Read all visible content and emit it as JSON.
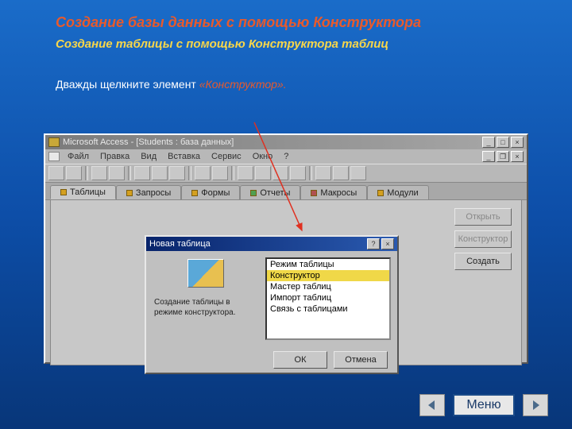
{
  "heading_main": "Создание базы данных с помощью Конструктора",
  "heading_sub": "Создание таблицы с помощью Конструктора таблиц",
  "instruction_white": "Дважды щелкните элемент ",
  "instruction_orange": "«Конструктор».",
  "window": {
    "title": "Microsoft Access - [Students : база данных]",
    "menus": [
      "Файл",
      "Правка",
      "Вид",
      "Вставка",
      "Сервис",
      "Окно",
      "?"
    ],
    "tabs": [
      "Таблицы",
      "Запросы",
      "Формы",
      "Отчеты",
      "Макросы",
      "Модули"
    ],
    "sidebuttons": {
      "open": "Открыть",
      "design": "Конструктор",
      "create": "Создать"
    }
  },
  "dialog": {
    "title": "Новая таблица",
    "caption": "Создание таблицы в режиме конструктора.",
    "list": [
      "Режим таблицы",
      "Конструктор",
      "Мастер таблиц",
      "Импорт таблиц",
      "Связь с таблицами"
    ],
    "selected_index": 1,
    "ok": "ОК",
    "cancel": "Отмена"
  },
  "footer_menu": "Меню"
}
